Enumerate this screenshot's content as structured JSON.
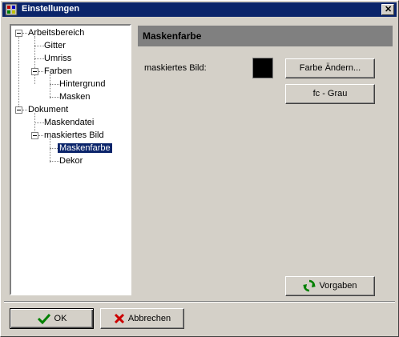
{
  "window": {
    "title": "Einstellungen",
    "close_glyph": "✕"
  },
  "tree": {
    "items": [
      {
        "label": "Arbeitsbereich"
      },
      {
        "label": "Gitter"
      },
      {
        "label": "Umriss"
      },
      {
        "label": "Farben"
      },
      {
        "label": "Hintergrund"
      },
      {
        "label": "Masken"
      },
      {
        "label": "Dokument"
      },
      {
        "label": "Maskendatei"
      },
      {
        "label": "maskiertes Bild"
      },
      {
        "label": "Maskenfarbe"
      },
      {
        "label": "Dekor"
      }
    ],
    "selected": "Maskenfarbe"
  },
  "panel": {
    "title": "Maskenfarbe",
    "field_label": "maskiertes Bild:",
    "swatch_color": "#000000",
    "change_color_button": "Farbe Ändern...",
    "grey_button": "fc - Grau",
    "defaults_button": "Vorgaben"
  },
  "footer": {
    "ok_button": "OK",
    "cancel_button": "Abbrechen"
  },
  "colors": {
    "title_bar": "#0a246a",
    "face": "#d4d0c8",
    "header": "#808080"
  }
}
